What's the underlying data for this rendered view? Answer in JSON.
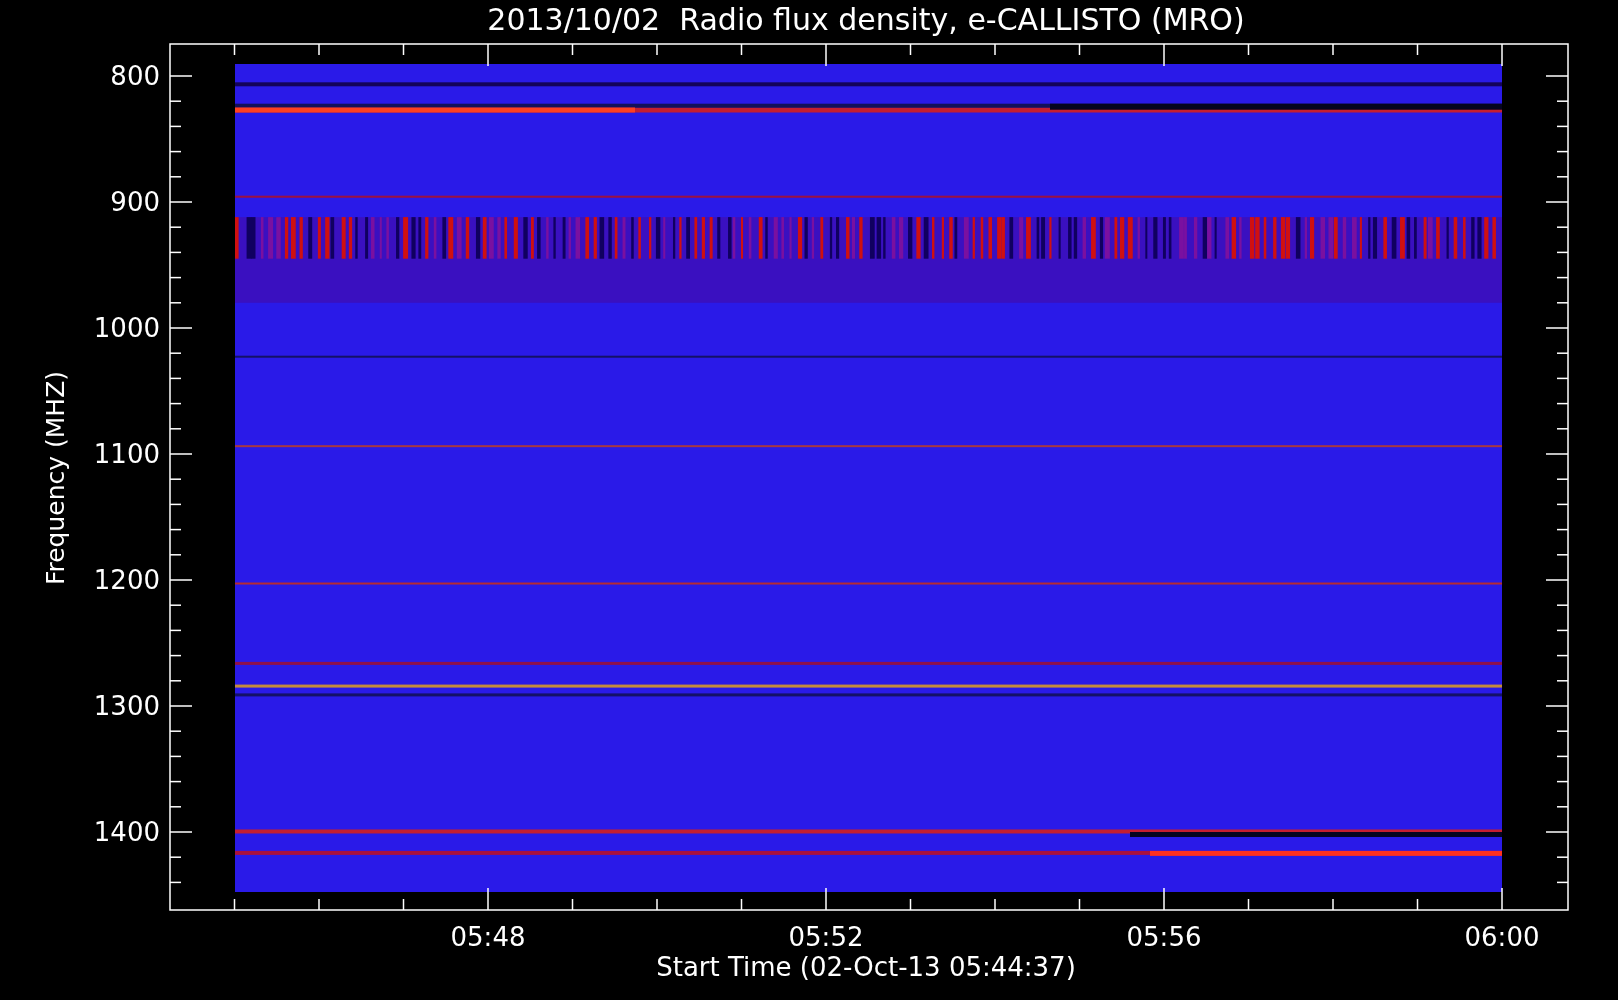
{
  "title": "2013/10/02  Radio flux density, e-CALLISTO (MRO)",
  "y_axis": {
    "label": "Frequency (MHZ)",
    "ticks": [
      "800",
      "900",
      "1000",
      "1100",
      "1200",
      "1300",
      "1400"
    ]
  },
  "x_axis": {
    "label": "Start Time (02-Oct-13 05:44:37)",
    "ticks": [
      "05:48",
      "05:52",
      "05:56",
      "06:00"
    ]
  }
}
